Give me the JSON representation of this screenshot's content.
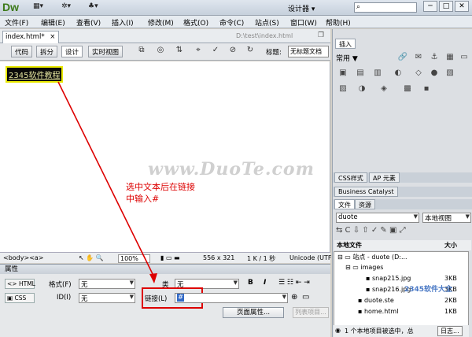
{
  "app": {
    "logo": "Dw",
    "workspace": "设计器",
    "workspace_arrow": "▾",
    "window_controls": [
      "─",
      "□",
      "✕"
    ]
  },
  "menus": [
    "文件(F)",
    "编辑(E)",
    "查看(V)",
    "插入(I)",
    "修改(M)",
    "格式(O)",
    "命令(C)",
    "站点(S)",
    "窗口(W)",
    "帮助(H)"
  ],
  "document": {
    "tab_label": "index.html*",
    "tab_close": "×",
    "path": "D:\\test\\index.html",
    "view_buttons": [
      "代码",
      "拆分",
      "设计",
      "实时视图"
    ],
    "title_label": "标题:",
    "title_value": "无标题文档",
    "selected_text": "2345软件教程",
    "watermark": "www.DuoTe.com",
    "annotation_line1": "选中文本后在链接",
    "annotation_line2": "中输入#"
  },
  "status": {
    "tags": "<body><a>",
    "zoom": "100%",
    "size": "556 x 321",
    "stats": "1 K / 1 秒",
    "encoding": "Unicode (UTF"
  },
  "properties": {
    "title": "属性",
    "html_button": "HTML",
    "css_button": "CSS",
    "format_label": "格式(F)",
    "format_value": "无",
    "class_label": "类",
    "class_value": "无",
    "id_label": "ID(I)",
    "id_value": "无",
    "link_label": "链接(L)",
    "link_value": "#",
    "bold": "B",
    "italic": "I",
    "page_props_button": "页面属性...",
    "list_items_button": "列表项目..."
  },
  "right_panel": {
    "insert_tab": "插入",
    "insert_category": "常用",
    "css_tab": "CSS样式",
    "ap_tab": "AP 元素",
    "bc_tab": "Business Catalyst",
    "files_tab": "文件",
    "assets_tab": "资源",
    "site_select": "duote",
    "view_select": "本地视图",
    "col_local_files": "本地文件",
    "col_size": "大小",
    "tree": [
      {
        "label": "站点 - duote (D:...",
        "size": ""
      },
      {
        "label": "images",
        "size": ""
      },
      {
        "label": "snap215.jpg",
        "size": "3KB"
      },
      {
        "label": "snap216.jpg",
        "size": "3KB"
      },
      {
        "label": "duote.ste",
        "size": "2KB"
      },
      {
        "label": "home.html",
        "size": "1KB"
      }
    ],
    "files_status": "1 个本地项目被选中，总",
    "log_button": "日志...",
    "watermark2": "2345软件大全"
  }
}
